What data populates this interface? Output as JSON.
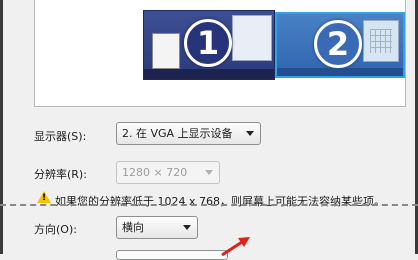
{
  "preview": {
    "monitors": [
      {
        "number": "1",
        "selected": false
      },
      {
        "number": "2",
        "selected": true
      }
    ]
  },
  "display": {
    "label": "显示器(S):",
    "selected": "2. 在 VGA 上显示设备"
  },
  "resolution": {
    "label": "分辨率(R):",
    "selected": "1280 × 720",
    "disabled": true
  },
  "warning": {
    "text": "如果您的分辨率低于 1024 x 768，则屏幕上可能无法容纳某些项。"
  },
  "orientation": {
    "label": "方向(O):",
    "selected": "横向"
  },
  "colors": {
    "accent": "#2fa2e8",
    "warning": "#f5c400",
    "annotation": "#e0201c"
  },
  "icons": [
    "warning-icon",
    "chevron-down-icon",
    "red-arrow-annotation"
  ]
}
